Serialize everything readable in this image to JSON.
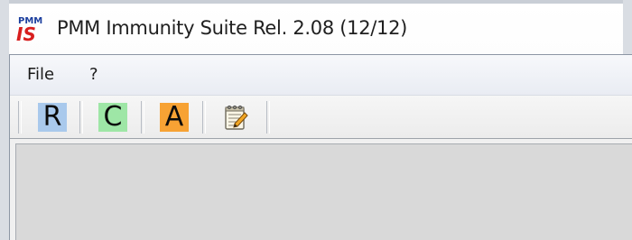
{
  "window": {
    "title": "PMM Immunity Suite  Rel. 2.08 (12/12)",
    "logo_text_top": "PMM",
    "logo_text_bottom": "IS"
  },
  "menu": {
    "items": [
      {
        "id": "file",
        "label": "File"
      },
      {
        "id": "help",
        "label": "?"
      }
    ]
  },
  "toolbar": {
    "buttons": [
      {
        "id": "r",
        "label": "R",
        "bg": "#a9c9ec"
      },
      {
        "id": "c",
        "label": "C",
        "bg": "#9ee6a6"
      },
      {
        "id": "a",
        "label": "A",
        "bg": "#f7a234"
      },
      {
        "id": "notes",
        "icon": "notepad-pencil-icon"
      }
    ]
  },
  "colors": {
    "logo_red": "#d81e1e",
    "logo_blue": "#1c3f9e"
  }
}
